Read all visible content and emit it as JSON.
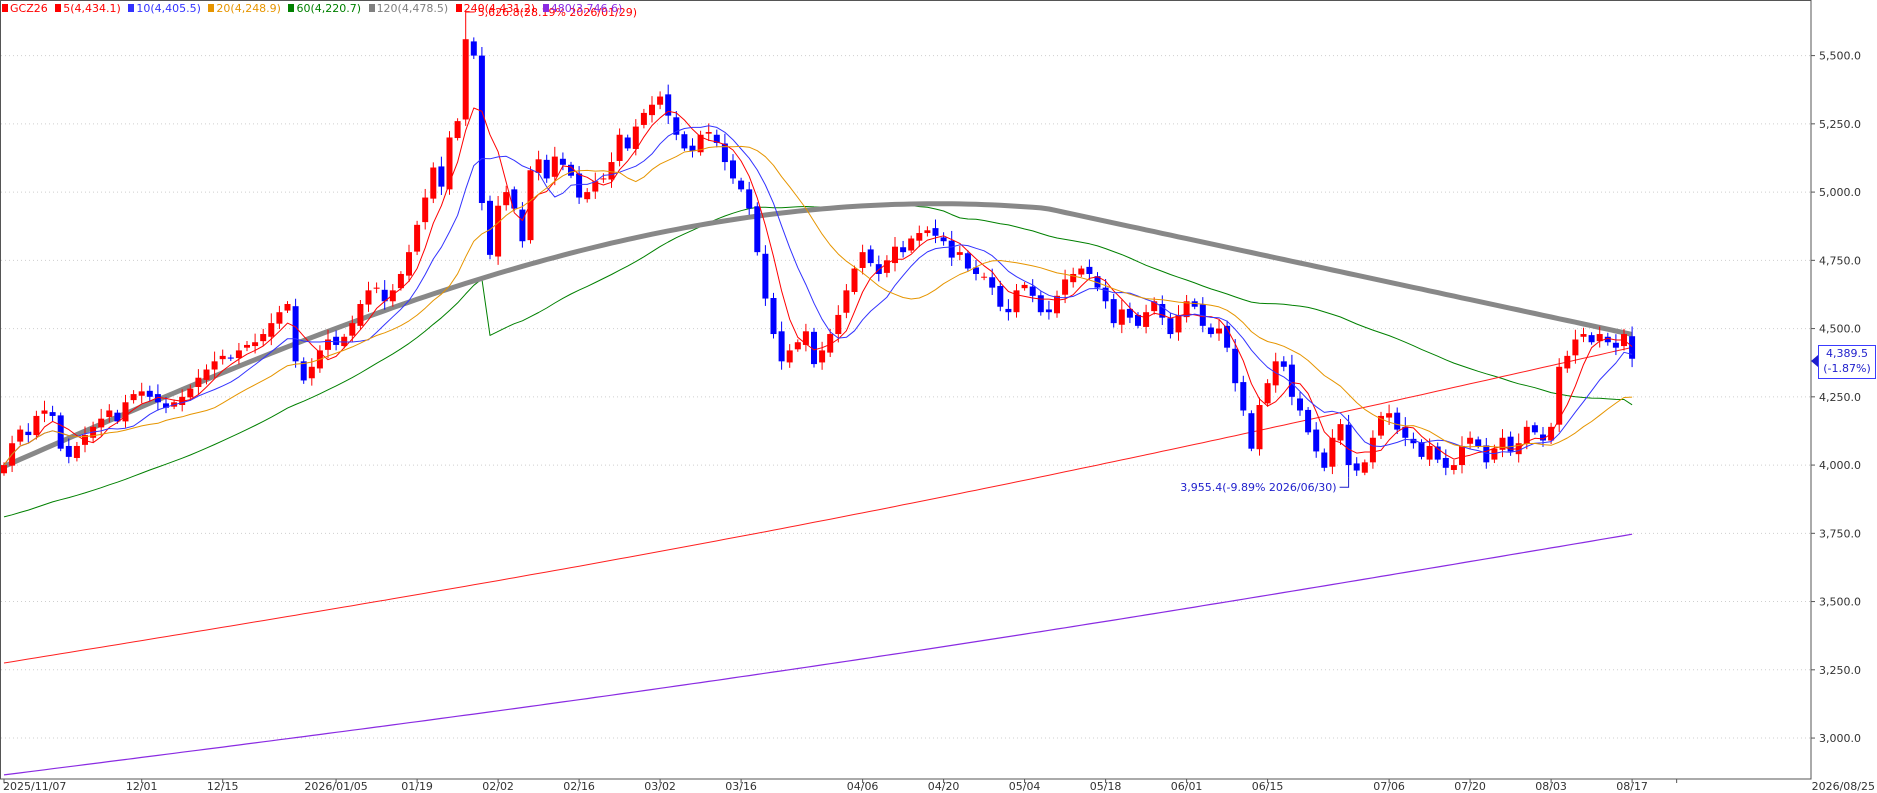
{
  "legend": [
    {
      "label": "GCZ26",
      "color": "#ff0000"
    },
    {
      "label": "5(4,434.1)",
      "color": "#ff0000"
    },
    {
      "label": "10(4,405.5)",
      "color": "#3333ff"
    },
    {
      "label": "20(4,248.9)",
      "color": "#e69500"
    },
    {
      "label": "60(4,220.7)",
      "color": "#008000"
    },
    {
      "label": "120(4,478.5)",
      "color": "#808080"
    },
    {
      "label": "240(4,431.2)",
      "color": "#ff0000"
    },
    {
      "label": "480(3,746.6)",
      "color": "#8a2be2"
    }
  ],
  "price_tag": {
    "price": "4,389.5",
    "change": "(-1.87%)"
  },
  "annotations": {
    "high": "5,626.8(28.19% 2026/01/29)",
    "low": "3,955.4(-9.89% 2026/06/30)"
  },
  "chart_data": {
    "type": "candlestick",
    "symbol": "GCZ26",
    "ylim": [
      2850,
      5700
    ],
    "y_ticks": [
      "3,000.0",
      "3,250.0",
      "3,500.0",
      "3,750.0",
      "4,000.0",
      "4,250.0",
      "4,500.0",
      "4,750.0",
      "5,000.0",
      "5,250.0",
      "5,500.0"
    ],
    "y_tick_values": [
      3000,
      3250,
      3500,
      3750,
      4000,
      4250,
      4500,
      4750,
      5000,
      5250,
      5500
    ],
    "x_ticks": [
      "2025/11/07",
      "12/01",
      "12/15",
      "2026/01/05",
      "01/19",
      "02/02",
      "02/16",
      "03/02",
      "03/16",
      "04/06",
      "04/20",
      "05/04",
      "05/18",
      "06/01",
      "06/15",
      "07/06",
      "07/20",
      "08/03",
      "08/17",
      "2026/08/25"
    ],
    "x_tick_bars": [
      0,
      17,
      27,
      41,
      51,
      61,
      71,
      81,
      91,
      106,
      116,
      126,
      136,
      146,
      156,
      171,
      181,
      191,
      201,
      206.5
    ],
    "closes": [
      4000,
      4080,
      4130,
      4110,
      4180,
      4200,
      4180,
      4060,
      4030,
      4070,
      4110,
      4140,
      4170,
      4200,
      4160,
      4230,
      4260,
      4270,
      4250,
      4230,
      4210,
      4230,
      4250,
      4280,
      4320,
      4350,
      4380,
      4400,
      4390,
      4420,
      4440,
      4450,
      4480,
      4520,
      4560,
      4590,
      4380,
      4310,
      4360,
      4420,
      4460,
      4440,
      4470,
      4520,
      4590,
      4640,
      4650,
      4600,
      4640,
      4700,
      4780,
      4880,
      4980,
      5090,
      5020,
      5200,
      5260,
      5560,
      5500,
      4960,
      4770,
      4950,
      5000,
      4940,
      4820,
      5080,
      5120,
      5050,
      5130,
      5100,
      5060,
      4980,
      5000,
      5040,
      5050,
      5110,
      5210,
      5160,
      5240,
      5290,
      5320,
      5350,
      5280,
      5210,
      5160,
      5150,
      5210,
      5220,
      5180,
      5110,
      5050,
      5010,
      4940,
      4780,
      4610,
      4480,
      4380,
      4420,
      4450,
      4490,
      4370,
      4420,
      4480,
      4550,
      4640,
      4720,
      4780,
      4740,
      4700,
      4750,
      4800,
      4780,
      4830,
      4850,
      4860,
      4840,
      4820,
      4760,
      4780,
      4720,
      4700,
      4690,
      4650,
      4580,
      4560,
      4640,
      4660,
      4620,
      4560,
      4560,
      4620,
      4680,
      4700,
      4720,
      4700,
      4650,
      4600,
      4520,
      4570,
      4540,
      4510,
      4560,
      4600,
      4540,
      4480,
      4550,
      4600,
      4580,
      4510,
      4480,
      4500,
      4430,
      4300,
      4200,
      4060,
      4220,
      4300,
      4380,
      4360,
      4250,
      4200,
      4120,
      4050,
      3990,
      4100,
      4150,
      4000,
      3980,
      4010,
      4100,
      4180,
      4190,
      4130,
      4100,
      4080,
      4030,
      4070,
      4020,
      3990,
      4000,
      4070,
      4100,
      4070,
      4010,
      4060,
      4100,
      4050,
      4080,
      4140,
      4120,
      4090,
      4140,
      4360,
      4400,
      4460,
      4480,
      4450,
      4480,
      4450,
      4430,
      4480,
      4389.5
    ],
    "high": {
      "value": 5626.8,
      "date": "2026/01/29"
    },
    "low": {
      "value": 3955.4,
      "date": "2026/06/30"
    },
    "moving_averages": [
      {
        "period": 5,
        "last": 4434.1,
        "color": "#ff0000",
        "width": 1
      },
      {
        "period": 10,
        "last": 4405.5,
        "color": "#3333ff",
        "width": 1
      },
      {
        "period": 20,
        "last": 4248.9,
        "color": "#e69500",
        "width": 1
      },
      {
        "period": 60,
        "last": 4220.7,
        "color": "#008000",
        "width": 1
      },
      {
        "period": 120,
        "last": 4478.5,
        "color": "#888888",
        "width": 5
      },
      {
        "period": 240,
        "last": 4431.2,
        "color": "#ff2020",
        "width": 1
      },
      {
        "period": 480,
        "last": 3746.6,
        "color": "#8a2be2",
        "width": 1.2
      }
    ],
    "grid": true,
    "up_color": "#ff0000",
    "down_color": "#0000ff"
  }
}
